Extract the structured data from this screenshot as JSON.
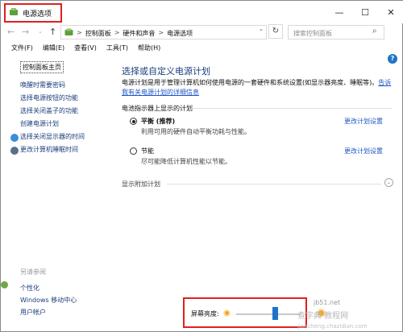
{
  "window": {
    "title": "电源选项",
    "controls": {
      "minimize": "—",
      "maximize": "☐",
      "close": "✕"
    }
  },
  "address": {
    "back": "←",
    "forward": "→",
    "recent": "⌄",
    "up": "↑",
    "crumbs": [
      "控制面板",
      "硬件和声音",
      "电源选项"
    ],
    "separator": ">",
    "dropdown": "⌄",
    "refresh": "↻",
    "search_placeholder": "搜索控制面板",
    "search_glyph": "⌕"
  },
  "menu": {
    "items": [
      "文件(F)",
      "编辑(E)",
      "查看(V)",
      "工具(T)",
      "帮助(H)"
    ],
    "help_badge": "?"
  },
  "sidebar": {
    "home": "控制面板主页",
    "tasks": [
      "唤醒时需要密码",
      "选择电源按钮的功能",
      "选择关闭盖子的功能",
      "创建电源计划",
      "选择关闭显示器的时间",
      "更改计算机睡眠时间"
    ],
    "see_also_title": "另请参阅",
    "see_also": [
      "个性化",
      "Windows 移动中心",
      "用户帐户"
    ]
  },
  "main": {
    "title": "选择或自定义电源计划",
    "intro": "电源计划是用于管理计算机如何使用电源的一套硬件和系统设置(如显示器亮度、睡眠等)。",
    "intro_link": "告诉我有关电源计划的详细信息",
    "section_label": "电池指示器上显示的计划",
    "plans": [
      {
        "name": "平衡 (推荐)",
        "desc": "利用可用的硬件自动平衡功耗与性能。",
        "change": "更改计划设置",
        "selected": true
      },
      {
        "name": "节能",
        "desc": "尽可能降低计算机性能以节能。",
        "change": "更改计划设置",
        "selected": false
      }
    ],
    "extra": "显示附加计划",
    "extra_toggle": "⌄"
  },
  "bottom": {
    "brightness_label": "屏幕亮度:",
    "brightness_fraction": 0.6
  },
  "watermark": {
    "line1": "jb51.net",
    "line2": "查字典 教程网",
    "line3": "jiaocheng.chazidian.com"
  },
  "colors": {
    "accent": "#1e73c8",
    "link": "#1e56c6",
    "highlight_box": "#e02020"
  }
}
